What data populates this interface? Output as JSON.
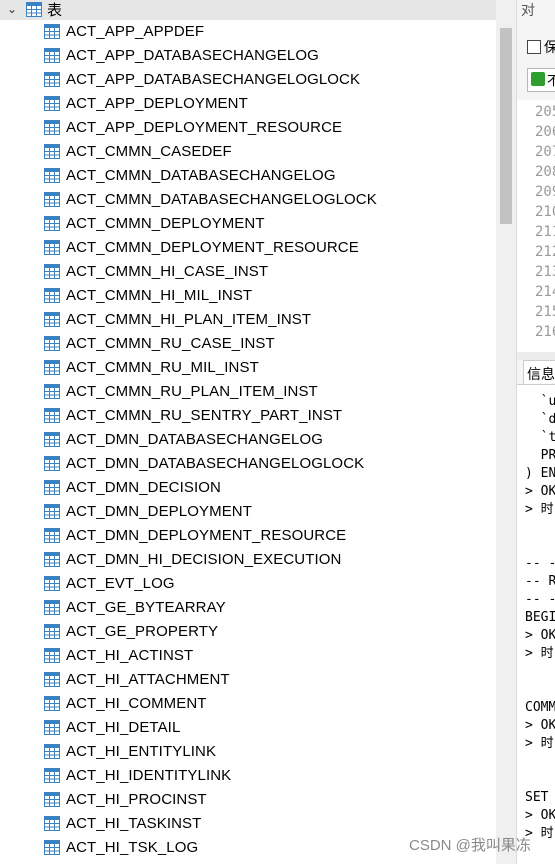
{
  "tree": {
    "header_label": "表",
    "tables": [
      "ACT_APP_APPDEF",
      "ACT_APP_DATABASECHANGELOG",
      "ACT_APP_DATABASECHANGELOGLOCK",
      "ACT_APP_DEPLOYMENT",
      "ACT_APP_DEPLOYMENT_RESOURCE",
      "ACT_CMMN_CASEDEF",
      "ACT_CMMN_DATABASECHANGELOG",
      "ACT_CMMN_DATABASECHANGELOGLOCK",
      "ACT_CMMN_DEPLOYMENT",
      "ACT_CMMN_DEPLOYMENT_RESOURCE",
      "ACT_CMMN_HI_CASE_INST",
      "ACT_CMMN_HI_MIL_INST",
      "ACT_CMMN_HI_PLAN_ITEM_INST",
      "ACT_CMMN_RU_CASE_INST",
      "ACT_CMMN_RU_MIL_INST",
      "ACT_CMMN_RU_PLAN_ITEM_INST",
      "ACT_CMMN_RU_SENTRY_PART_INST",
      "ACT_DMN_DATABASECHANGELOG",
      "ACT_DMN_DATABASECHANGELOGLOCK",
      "ACT_DMN_DECISION",
      "ACT_DMN_DEPLOYMENT",
      "ACT_DMN_DEPLOYMENT_RESOURCE",
      "ACT_DMN_HI_DECISION_EXECUTION",
      "ACT_EVT_LOG",
      "ACT_GE_BYTEARRAY",
      "ACT_GE_PROPERTY",
      "ACT_HI_ACTINST",
      "ACT_HI_ATTACHMENT",
      "ACT_HI_COMMENT",
      "ACT_HI_DETAIL",
      "ACT_HI_ENTITYLINK",
      "ACT_HI_IDENTITYLINK",
      "ACT_HI_PROCINST",
      "ACT_HI_TASKINST",
      "ACT_HI_TSK_LOG"
    ]
  },
  "right_pane": {
    "tab_label": "对",
    "save_label": "保",
    "run_glyph": "不",
    "line_numbers": [
      "205",
      "206",
      "207",
      "208",
      "209",
      "210",
      "211",
      "212",
      "213",
      "214",
      "215",
      "216"
    ],
    "info_tab_label": "信息",
    "console_lines": [
      "  `u",
      "  `d",
      "  `t",
      "  PR",
      ") EN",
      "> OK",
      "> 时",
      "",
      "",
      "-- -",
      "-- R",
      "-- -",
      "BEGI",
      "> OK",
      "> 时",
      "",
      "",
      "COMM",
      "> OK",
      "> 时",
      "",
      "",
      "SET ",
      "> OK",
      "> 时"
    ]
  },
  "watermark": "CSDN @我叫果冻",
  "colors": {
    "header_bg": "#e6e6e6",
    "icon_blue": "#3b82c4",
    "scroll_thumb": "#c2c2c2"
  }
}
